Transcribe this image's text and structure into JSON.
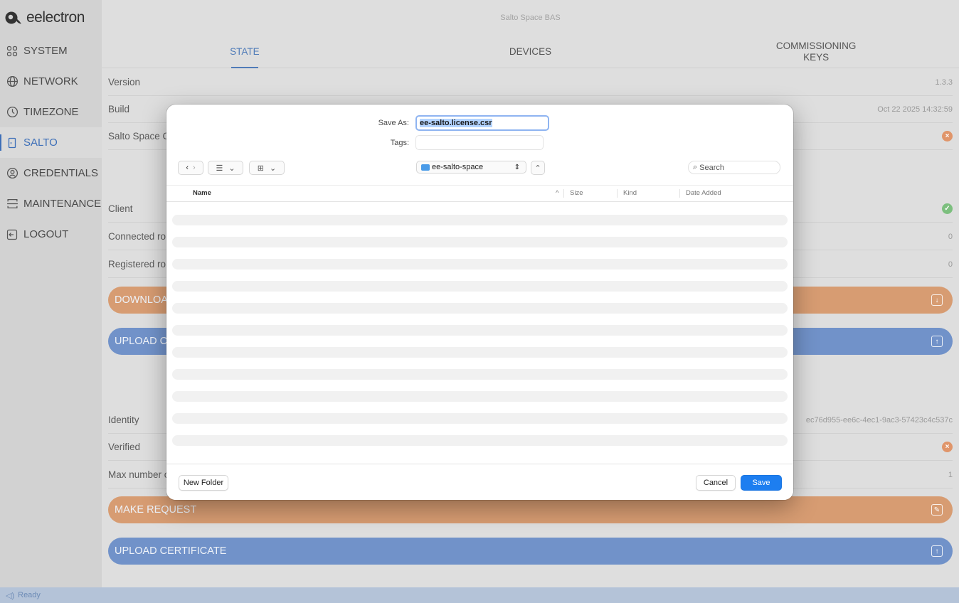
{
  "app": {
    "brand": "eelectron",
    "window_title": "Salto Space BAS"
  },
  "sidebar": {
    "items": [
      {
        "label": "SYSTEM",
        "icon": "grid-icon",
        "active": false
      },
      {
        "label": "NETWORK",
        "icon": "globe-icon",
        "active": false
      },
      {
        "label": "TIMEZONE",
        "icon": "clock-icon",
        "active": false
      },
      {
        "label": "SALTO",
        "icon": "door-icon",
        "active": true
      },
      {
        "label": "CREDENTIALS",
        "icon": "badge-icon",
        "active": false
      },
      {
        "label": "MAINTENANCE",
        "icon": "wrench-icon",
        "active": false
      },
      {
        "label": "LOGOUT",
        "icon": "logout-icon",
        "active": false
      }
    ]
  },
  "tabs": [
    {
      "label": "STATE",
      "active": true
    },
    {
      "label": "DEVICES",
      "active": false
    },
    {
      "label": "COMMISSIONING KEYS",
      "active": false
    }
  ],
  "rows": {
    "version": {
      "label": "Version",
      "value": "1.3.3"
    },
    "build": {
      "label": "Build",
      "value": "Oct 22 2025 14:32:59"
    },
    "salto_space": {
      "label": "Salto Space C",
      "status": "error"
    },
    "client": {
      "label": "Client",
      "status": "ok"
    },
    "connected": {
      "label": "Connected ro",
      "value": "0"
    },
    "registered": {
      "label": "Registered ro",
      "value": "0"
    },
    "identity": {
      "label": "Identity",
      "value": "ec76d955-ee6c-4ec1-9ac3-57423c4c537c"
    },
    "verified": {
      "label": "Verified",
      "status": "error"
    },
    "max_number": {
      "label": "Max number o",
      "value": "1"
    }
  },
  "buttons": {
    "download": "DOWNLOA",
    "upload_top": "UPLOAD C",
    "make_request": "MAKE REQUEST",
    "upload_certificate": "UPLOAD CERTIFICATE"
  },
  "status_bar": {
    "text": "Ready"
  },
  "dialog": {
    "save_as_label": "Save As:",
    "filename_selected": "ee-salto.license",
    "filename_ext": ".csr",
    "tags_label": "Tags:",
    "folder": "ee-salto-space",
    "search_placeholder": "Search",
    "columns": [
      "Name",
      "Size",
      "Kind",
      "Date Added"
    ],
    "new_folder": "New Folder",
    "cancel": "Cancel",
    "save": "Save"
  },
  "colors": {
    "accent_blue": "#4f7bb8",
    "button_orange": "#d79c72",
    "button_blue": "#7192c9",
    "status_ok": "#7cbf7e",
    "status_error": "#e0956a",
    "dialog_save": "#1d7ef0"
  }
}
